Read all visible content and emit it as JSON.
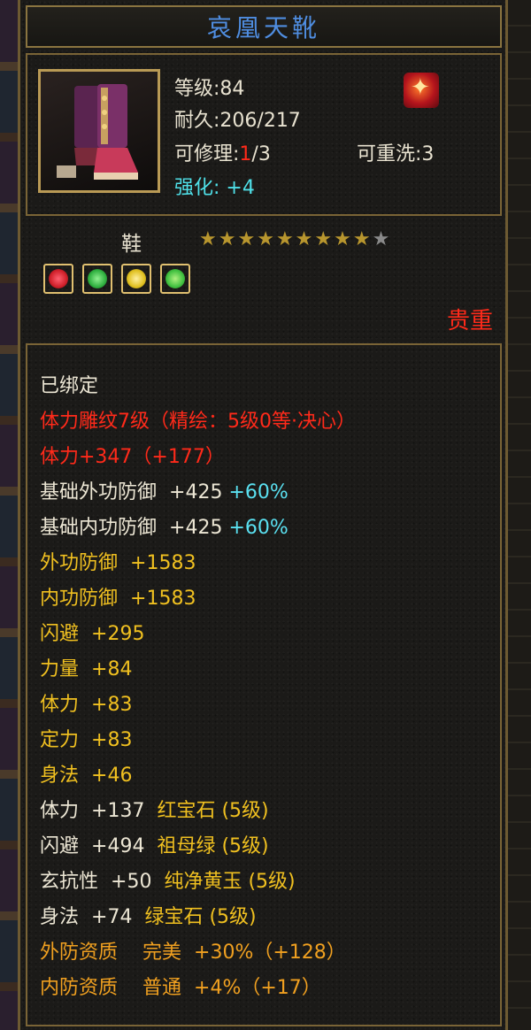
{
  "item": {
    "name": "哀凰天靴",
    "level": "等级:84",
    "durability": "耐久:206/217",
    "repair_label": "可修理:",
    "repair_cur": "1",
    "repair_total": "/3",
    "rewash": "可重洗:3",
    "enhance_label": "强化:",
    "enhance_value": "+4",
    "slot": "鞋",
    "stars_filled": 9,
    "stars_total": 10,
    "rarity": "贵重",
    "icon": "boots-icon",
    "badge_icon": "flame-emblem-icon"
  },
  "gems": [
    {
      "icon": "red-gem-icon",
      "color": "#d0202a"
    },
    {
      "icon": "green-gem-icon",
      "color": "#30b040"
    },
    {
      "icon": "yellow-gem-icon",
      "color": "#e0c020"
    },
    {
      "icon": "green-gem-icon",
      "color": "#40c040"
    }
  ],
  "attributes": {
    "bound": "已绑定",
    "engrave": "体力雕纹7级（精绘：5级0等·决心）",
    "vit_bonus": "体力+347（+177）",
    "base_outer_def": "基础外功防御",
    "base_outer_def_val": "+425",
    "base_outer_def_pct": "+60%",
    "base_inner_def": "基础内功防御",
    "base_inner_def_val": "+425",
    "base_inner_def_pct": "+60%",
    "outer_def": "外功防御",
    "outer_def_val": "+1583",
    "inner_def": "内功防御",
    "inner_def_val": "+1583",
    "dodge": "闪避",
    "dodge_val": "+295",
    "str": "力量",
    "str_val": "+84",
    "vit": "体力",
    "vit_val": "+83",
    "spirit": "定力",
    "spirit_val": "+83",
    "agi": "身法",
    "agi_val": "+46",
    "gem1_stat": "体力",
    "gem1_val": "+137",
    "gem1_name": "红宝石 (5级)",
    "gem2_stat": "闪避",
    "gem2_val": "+494",
    "gem2_name": "祖母绿 (5级)",
    "gem3_stat": "玄抗性",
    "gem3_val": "+50",
    "gem3_name": "纯净黄玉 (5级)",
    "gem4_stat": "身法",
    "gem4_val": "+74",
    "gem4_name": "绿宝石 (5级)",
    "q1_label": "外防资质",
    "q1_grade": "完美",
    "q1_val": "+30%（+128）",
    "q2_label": "内防资质",
    "q2_grade": "普通",
    "q2_val": "+4%（+17）"
  },
  "colors": {
    "title": "#4f8de0",
    "red": "#ff2a1a",
    "gold": "#f0c020",
    "orange": "#f0a020",
    "cyan": "#5ae0f0",
    "border": "#7a6436"
  }
}
